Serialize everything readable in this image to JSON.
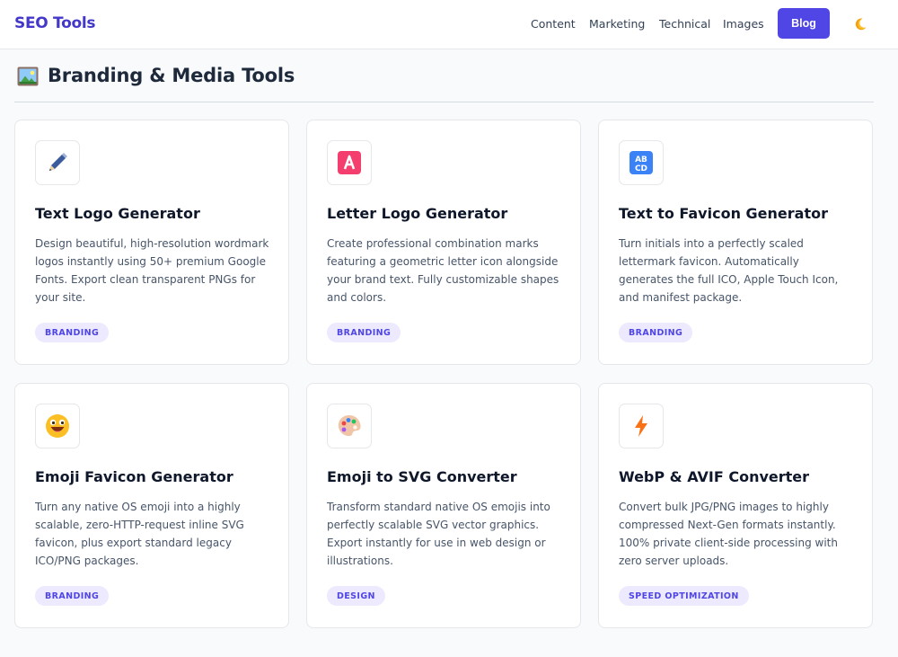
{
  "header": {
    "brand": "SEO Tools",
    "nav": [
      {
        "label": "Content"
      },
      {
        "label": "Marketing"
      },
      {
        "label": "Technical"
      },
      {
        "label": "Images"
      }
    ],
    "blog_label": "Blog",
    "theme_icon": "moon-icon",
    "accent": "#4f46e5"
  },
  "section": {
    "icon": "framed-picture-icon",
    "title": "Branding & Media Tools"
  },
  "cards": [
    {
      "icon": "pencil-icon",
      "title": "Text Logo Generator",
      "desc": "Design beautiful, high-resolution wordmark logos instantly using 50+ premium Google Fonts. Export clean transparent PNGs for your site.",
      "tag": "BRANDING"
    },
    {
      "icon": "letter-a-icon",
      "title": "Letter Logo Generator",
      "desc": "Create professional combination marks featuring a geometric letter icon alongside your brand text. Fully customizable shapes and colors.",
      "tag": "BRANDING"
    },
    {
      "icon": "abcd-icon",
      "title": "Text to Favicon Generator",
      "desc": "Turn initials into a perfectly scaled lettermark favicon. Automatically generates the full ICO, Apple Touch Icon, and manifest package.",
      "tag": "BRANDING"
    },
    {
      "icon": "grinning-face-icon",
      "title": "Emoji Favicon Generator",
      "desc": "Turn any native OS emoji into a highly scalable, zero-HTTP-request inline SVG favicon, plus export standard legacy ICO/PNG packages.",
      "tag": "BRANDING"
    },
    {
      "icon": "palette-icon",
      "title": "Emoji to SVG Converter",
      "desc": "Transform standard native OS emojis into perfectly scalable SVG vector graphics. Export instantly for use in web design or illustrations.",
      "tag": "DESIGN"
    },
    {
      "icon": "lightning-icon",
      "title": "WebP & AVIF Converter",
      "desc": "Convert bulk JPG/PNG images to highly compressed Next-Gen formats instantly. 100% private client-side processing with zero server uploads.",
      "tag": "SPEED OPTIMIZATION"
    }
  ]
}
